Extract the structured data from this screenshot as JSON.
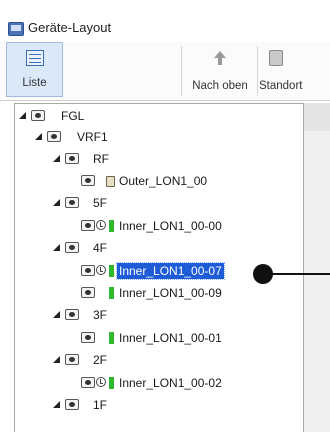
{
  "window": {
    "title": "Geräte-Layout"
  },
  "toolbar": {
    "liste_label": "Liste",
    "up_label": "Nach oben",
    "standort_label": "Standort"
  },
  "tree": {
    "root": {
      "label": "FGL"
    },
    "vrf": {
      "label": "VRF1"
    },
    "floors": [
      {
        "label": "RF",
        "devices": [
          {
            "label": "Outer_LON1_00",
            "status": "outer"
          }
        ]
      },
      {
        "label": "5F",
        "devices": [
          {
            "label": "Inner_LON1_00-00",
            "status": "inner",
            "timer": true
          }
        ]
      },
      {
        "label": "4F",
        "devices": [
          {
            "label": "Inner_LON1_00-07",
            "status": "inner",
            "timer": true,
            "selected": true
          },
          {
            "label": "Inner_LON1_00-09",
            "status": "inner",
            "timer": false
          }
        ]
      },
      {
        "label": "3F",
        "devices": [
          {
            "label": "Inner_LON1_00-01",
            "status": "inner",
            "timer": false
          }
        ]
      },
      {
        "label": "2F",
        "devices": [
          {
            "label": "Inner_LON1_00-02",
            "status": "inner",
            "timer": true
          }
        ]
      },
      {
        "label": "1F",
        "devices": []
      }
    ]
  },
  "colors": {
    "selection": "#1e5bd6",
    "status_green": "#2eb82e",
    "toolbar_active": "#dbe8f8"
  },
  "icons": {
    "app": "device-layout-icon",
    "liste": "list-view-icon",
    "up": "arrow-up-icon",
    "standort": "building-icon",
    "visibility": "eye-icon",
    "timer": "clock-icon"
  }
}
